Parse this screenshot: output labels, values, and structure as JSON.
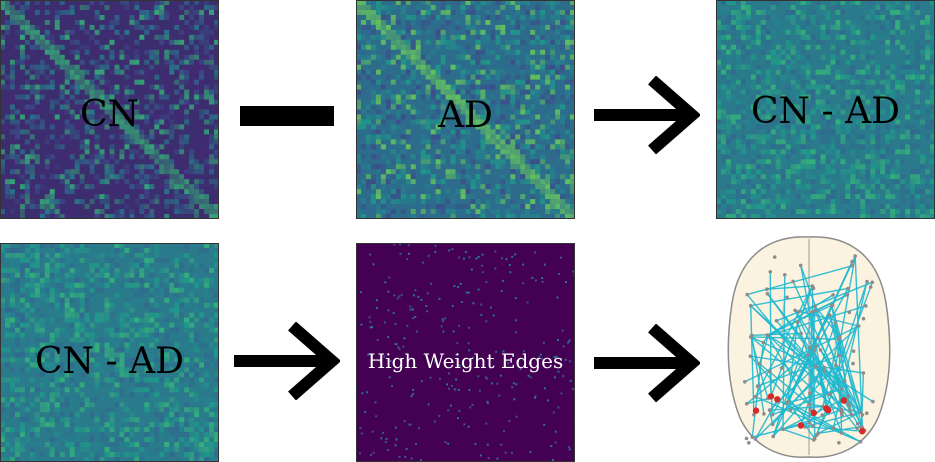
{
  "labels": {
    "cn": "CN",
    "ad": "AD",
    "diff_top": "CN - AD",
    "diff_bottom": "CN - AD",
    "high_weight": "High Weight Edges"
  },
  "colors": {
    "matrix_dark": "#3b2d6e",
    "matrix_mid": "#2c6d8c",
    "matrix_teal": "#2b8f8a",
    "matrix_bright": "#5ec962",
    "high_weight_bg": "#440154",
    "brain_fill": "#fbf3df",
    "brain_outline": "#8c8c8c",
    "edge_color": "#1fb8d0",
    "node_gray": "#8c8c8c",
    "node_red": "#d42a2a",
    "operator": "#000000"
  },
  "icons": {
    "minus": "minus-sign",
    "arrow": "right-arrow"
  }
}
